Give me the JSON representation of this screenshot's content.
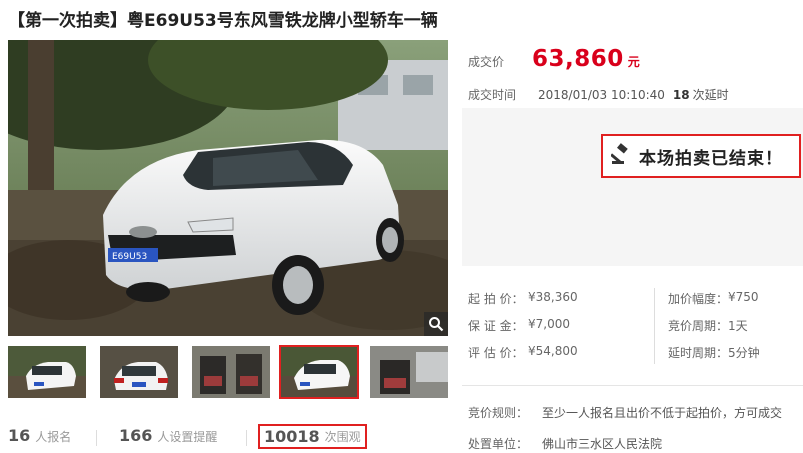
{
  "title": "【第一次拍卖】粤E69U53号东风雪铁龙牌小型轿车一辆",
  "photo": {
    "plate": "E69U53",
    "zoom_icon": "magnifier-icon"
  },
  "thumbnails": [
    {
      "name": "front-view",
      "selected": false
    },
    {
      "name": "rear-view",
      "selected": false
    },
    {
      "name": "interior-front",
      "selected": false
    },
    {
      "name": "front-view-large",
      "selected": true
    },
    {
      "name": "interior-rear",
      "selected": false
    }
  ],
  "stats": {
    "signups": {
      "num": "16",
      "label": "人报名"
    },
    "reminders": {
      "num": "166",
      "label": "人设置提醒"
    },
    "views": {
      "num": "10018",
      "label": "次围观"
    }
  },
  "deal": {
    "price_label": "成交价",
    "price": "63,860",
    "price_unit": "元",
    "time_label": "成交时间",
    "time": "2018/01/03 10:10:40",
    "extensions": "18",
    "extensions_label": "次延时"
  },
  "ended_text": "本场拍卖已结束！",
  "ended_icon": "gavel-icon",
  "details": [
    {
      "l1": "起 拍 价：",
      "v1": "¥38,360",
      "l2": "加价幅度：",
      "v2": "¥750"
    },
    {
      "l1": "保 证 金：",
      "v1": "¥7,000",
      "l2": "竞价周期：",
      "v2": "1天"
    },
    {
      "l1": "评 估 价：",
      "v1": "¥54,800",
      "l2": "延时周期：",
      "v2": "5分钟"
    }
  ],
  "rules": {
    "bid_rule_label": "竞价规则：",
    "bid_rule": "至少一人报名且出价不低于起拍价，方可成交",
    "org_label": "处置单位：",
    "org": "佛山市三水区人民法院"
  },
  "colors": {
    "accent": "#d9001b",
    "highlight_border": "#e02020",
    "panel_bg": "#f5f5f5"
  }
}
